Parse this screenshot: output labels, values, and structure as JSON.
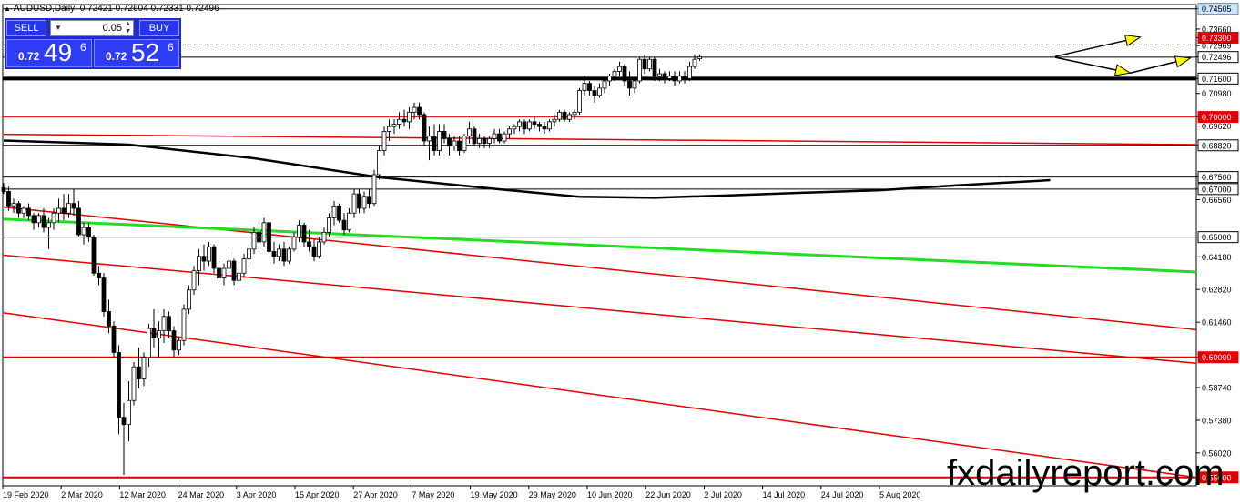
{
  "header": {
    "symbol": "AUDUSD,Daily",
    "open": "0.72421",
    "high": "0.72604",
    "low": "0.72331",
    "close": "0.72496"
  },
  "trade_panel": {
    "sell_label": "SELL",
    "buy_label": "BUY",
    "lot_size": "0.05",
    "sell_prefix": "0.72",
    "sell_main": "49",
    "sell_sup": "6",
    "buy_prefix": "0.72",
    "buy_main": "52",
    "buy_sup": "6"
  },
  "watermark": "fxdailyreport.com",
  "colors": {
    "up": "#ffffff",
    "down": "#000000",
    "level_red": "#e00000",
    "ma_green": "#22dd22",
    "ma_black": "#000000",
    "arrow": "#ffff00"
  },
  "chart_data": {
    "type": "candlestick",
    "title": "AUDUSD,Daily",
    "ylim": [
      0.5465,
      0.7468
    ],
    "grid": false,
    "x_ticks": [
      "19 Feb 2020",
      "2 Mar 2020",
      "12 Mar 2020",
      "24 Mar 2020",
      "3 Apr 2020",
      "15 Apr 2020",
      "27 Apr 2020",
      "7 May 2020",
      "19 May 2020",
      "29 May 2020",
      "10 Jun 2020",
      "22 Jun 2020",
      "2 Jul 2020",
      "14 Jul 2020",
      "24 Jul 2020",
      "5 Aug 2020"
    ],
    "y_ticks": [
      "0.74505",
      "0.73660",
      "0.73300",
      "0.72969",
      "0.72496",
      "0.71600",
      "0.70980",
      "0.70000",
      "0.69620",
      "0.68820",
      "0.67500",
      "0.67000",
      "0.66560",
      "0.65000",
      "0.64180",
      "0.62820",
      "0.61460",
      "0.60000",
      "0.58740",
      "0.57380",
      "0.56020",
      "0.55000"
    ],
    "highlighted_labels": [
      {
        "label": "0.74505",
        "value": 0.74505,
        "style": "blue"
      },
      {
        "label": "0.73300",
        "value": 0.733,
        "style": "red"
      },
      {
        "label": "0.72496",
        "value": 0.72496,
        "style": "current"
      },
      {
        "label": "0.71600",
        "value": 0.716,
        "style": "black"
      },
      {
        "label": "0.70000",
        "value": 0.7,
        "style": "red"
      },
      {
        "label": "0.68820",
        "value": 0.6882,
        "style": "black"
      },
      {
        "label": "0.67500",
        "value": 0.675,
        "style": "black"
      },
      {
        "label": "0.67000",
        "value": 0.67,
        "style": "black"
      },
      {
        "label": "0.65000",
        "value": 0.65,
        "style": "black"
      },
      {
        "label": "0.60000",
        "value": 0.6,
        "style": "red"
      },
      {
        "label": "0.55000",
        "value": 0.55,
        "style": "red"
      }
    ],
    "horizontal_levels": [
      {
        "value": 0.745,
        "color": "#000000",
        "width": 1
      },
      {
        "value": 0.73,
        "color": "#000000",
        "width": 1,
        "dash": true
      },
      {
        "value": 0.7249,
        "color": "#000000",
        "width": 1
      },
      {
        "value": 0.716,
        "color": "#000000",
        "width": 4
      },
      {
        "value": 0.7,
        "color": "#e00000",
        "width": 1
      },
      {
        "value": 0.6882,
        "color": "#000000",
        "width": 1
      },
      {
        "value": 0.675,
        "color": "#000000",
        "width": 1
      },
      {
        "value": 0.67,
        "color": "#000000",
        "width": 1
      },
      {
        "value": 0.65,
        "color": "#000000",
        "width": 1
      },
      {
        "value": 0.6,
        "color": "#e00000",
        "width": 2
      },
      {
        "value": 0.55,
        "color": "#e00000",
        "width": 2
      }
    ],
    "trendlines": [
      {
        "color": "#e00000",
        "width": 1.5,
        "from": [
          0,
          0.6928
        ],
        "to": [
          250,
          0.6885
        ]
      },
      {
        "color": "#e00000",
        "width": 1.5,
        "from": [
          0,
          0.6625
        ],
        "to": [
          250,
          0.6115
        ]
      },
      {
        "color": "#e00000",
        "width": 1.5,
        "from": [
          0,
          0.6425
        ],
        "to": [
          250,
          0.5975
        ]
      },
      {
        "color": "#e00000",
        "width": 1.5,
        "from": [
          0,
          0.6185
        ],
        "to": [
          250,
          0.55
        ]
      },
      {
        "color": "#22dd22",
        "width": 3,
        "from": [
          0,
          0.6575
        ],
        "to": [
          250,
          0.6355
        ]
      }
    ],
    "moving_average": {
      "color": "#000000",
      "points": [
        [
          0,
          0.6902
        ],
        [
          25,
          0.6885
        ],
        [
          50,
          0.6828
        ],
        [
          75,
          0.6749
        ],
        [
          100,
          0.6697
        ],
        [
          115,
          0.6668
        ],
        [
          130,
          0.6664
        ],
        [
          145,
          0.6674
        ],
        [
          160,
          0.6685
        ],
        [
          175,
          0.6695
        ],
        [
          190,
          0.6715
        ],
        [
          209,
          0.6737
        ]
      ]
    },
    "arrows": [
      {
        "from": [
          210,
          0.7252
        ],
        "to": [
          227,
          0.7332
        ]
      },
      {
        "from": [
          210,
          0.7248
        ],
        "to": [
          225,
          0.7183
        ]
      },
      {
        "from": [
          225,
          0.7183
        ],
        "to": [
          237,
          0.7245
        ]
      }
    ],
    "candles": [
      [
        0.6705,
        0.6725,
        0.668,
        0.669
      ],
      [
        0.669,
        0.671,
        0.661,
        0.663
      ],
      [
        0.663,
        0.666,
        0.66,
        0.664
      ],
      [
        0.664,
        0.665,
        0.658,
        0.66
      ],
      [
        0.66,
        0.663,
        0.658,
        0.662
      ],
      [
        0.662,
        0.664,
        0.657,
        0.659
      ],
      [
        0.659,
        0.66,
        0.653,
        0.656
      ],
      [
        0.656,
        0.66,
        0.654,
        0.659
      ],
      [
        0.659,
        0.662,
        0.652,
        0.654
      ],
      [
        0.654,
        0.658,
        0.645,
        0.656
      ],
      [
        0.656,
        0.662,
        0.653,
        0.66
      ],
      [
        0.66,
        0.666,
        0.656,
        0.662
      ],
      [
        0.662,
        0.668,
        0.657,
        0.66
      ],
      [
        0.66,
        0.668,
        0.658,
        0.664
      ],
      [
        0.664,
        0.67,
        0.659,
        0.662
      ],
      [
        0.662,
        0.665,
        0.65,
        0.651
      ],
      [
        0.651,
        0.656,
        0.647,
        0.654
      ],
      [
        0.654,
        0.656,
        0.648,
        0.65
      ],
      [
        0.65,
        0.651,
        0.634,
        0.635
      ],
      [
        0.635,
        0.638,
        0.63,
        0.633
      ],
      [
        0.633,
        0.635,
        0.617,
        0.619
      ],
      [
        0.619,
        0.624,
        0.61,
        0.613
      ],
      [
        0.613,
        0.615,
        0.6,
        0.602
      ],
      [
        0.602,
        0.605,
        0.568,
        0.575
      ],
      [
        0.575,
        0.581,
        0.551,
        0.572
      ],
      [
        0.572,
        0.59,
        0.565,
        0.582
      ],
      [
        0.582,
        0.598,
        0.58,
        0.596
      ],
      [
        0.596,
        0.604,
        0.587,
        0.591
      ],
      [
        0.591,
        0.602,
        0.588,
        0.6
      ],
      [
        0.6,
        0.614,
        0.596,
        0.612
      ],
      [
        0.612,
        0.62,
        0.604,
        0.608
      ],
      [
        0.608,
        0.615,
        0.6,
        0.611
      ],
      [
        0.611,
        0.62,
        0.606,
        0.617
      ],
      [
        0.617,
        0.619,
        0.608,
        0.611
      ],
      [
        0.611,
        0.613,
        0.6,
        0.603
      ],
      [
        0.603,
        0.608,
        0.601,
        0.607
      ],
      [
        0.607,
        0.622,
        0.605,
        0.62
      ],
      [
        0.62,
        0.63,
        0.618,
        0.628
      ],
      [
        0.628,
        0.638,
        0.626,
        0.636
      ],
      [
        0.636,
        0.645,
        0.63,
        0.642
      ],
      [
        0.642,
        0.647,
        0.636,
        0.64
      ],
      [
        0.64,
        0.648,
        0.638,
        0.646
      ],
      [
        0.646,
        0.647,
        0.635,
        0.637
      ],
      [
        0.637,
        0.64,
        0.629,
        0.633
      ],
      [
        0.633,
        0.639,
        0.63,
        0.637
      ],
      [
        0.637,
        0.644,
        0.635,
        0.64
      ],
      [
        0.64,
        0.641,
        0.63,
        0.632
      ],
      [
        0.632,
        0.638,
        0.628,
        0.635
      ],
      [
        0.635,
        0.643,
        0.633,
        0.641
      ],
      [
        0.641,
        0.647,
        0.639,
        0.645
      ],
      [
        0.645,
        0.654,
        0.643,
        0.652
      ],
      [
        0.652,
        0.656,
        0.645,
        0.648
      ],
      [
        0.648,
        0.658,
        0.646,
        0.656
      ],
      [
        0.656,
        0.656,
        0.643,
        0.644
      ],
      [
        0.644,
        0.648,
        0.639,
        0.642
      ],
      [
        0.642,
        0.647,
        0.64,
        0.645
      ],
      [
        0.645,
        0.648,
        0.638,
        0.64
      ],
      [
        0.64,
        0.646,
        0.639,
        0.645
      ],
      [
        0.645,
        0.652,
        0.644,
        0.65
      ],
      [
        0.65,
        0.657,
        0.648,
        0.655
      ],
      [
        0.655,
        0.656,
        0.646,
        0.648
      ],
      [
        0.648,
        0.653,
        0.644,
        0.646
      ],
      [
        0.646,
        0.649,
        0.64,
        0.642
      ],
      [
        0.642,
        0.65,
        0.641,
        0.648
      ],
      [
        0.648,
        0.654,
        0.647,
        0.652
      ],
      [
        0.652,
        0.66,
        0.65,
        0.658
      ],
      [
        0.658,
        0.665,
        0.655,
        0.663
      ],
      [
        0.663,
        0.664,
        0.656,
        0.657
      ],
      [
        0.657,
        0.66,
        0.651,
        0.653
      ],
      [
        0.653,
        0.662,
        0.652,
        0.66
      ],
      [
        0.66,
        0.67,
        0.658,
        0.668
      ],
      [
        0.668,
        0.67,
        0.66,
        0.662
      ],
      [
        0.662,
        0.669,
        0.66,
        0.667
      ],
      [
        0.667,
        0.67,
        0.662,
        0.664
      ],
      [
        0.664,
        0.678,
        0.663,
        0.676
      ],
      [
        0.676,
        0.688,
        0.674,
        0.686
      ],
      [
        0.686,
        0.696,
        0.684,
        0.694
      ],
      [
        0.694,
        0.699,
        0.69,
        0.696
      ],
      [
        0.696,
        0.699,
        0.693,
        0.697
      ],
      [
        0.697,
        0.702,
        0.695,
        0.699
      ],
      [
        0.699,
        0.703,
        0.696,
        0.698
      ],
      [
        0.698,
        0.704,
        0.695,
        0.702
      ],
      [
        0.702,
        0.706,
        0.699,
        0.704
      ],
      [
        0.704,
        0.706,
        0.699,
        0.701
      ],
      [
        0.701,
        0.702,
        0.688,
        0.69
      ],
      [
        0.69,
        0.696,
        0.682,
        0.692
      ],
      [
        0.692,
        0.697,
        0.684,
        0.686
      ],
      [
        0.686,
        0.697,
        0.684,
        0.694
      ],
      [
        0.694,
        0.697,
        0.689,
        0.691
      ],
      [
        0.691,
        0.693,
        0.684,
        0.688
      ],
      [
        0.688,
        0.692,
        0.686,
        0.69
      ],
      [
        0.69,
        0.692,
        0.684,
        0.686
      ],
      [
        0.686,
        0.693,
        0.685,
        0.692
      ],
      [
        0.692,
        0.698,
        0.689,
        0.695
      ],
      [
        0.695,
        0.696,
        0.688,
        0.689
      ],
      [
        0.689,
        0.693,
        0.687,
        0.691
      ],
      [
        0.691,
        0.692,
        0.687,
        0.689
      ],
      [
        0.689,
        0.692,
        0.687,
        0.691
      ],
      [
        0.691,
        0.695,
        0.689,
        0.693
      ],
      [
        0.693,
        0.695,
        0.689,
        0.69
      ],
      [
        0.69,
        0.694,
        0.689,
        0.693
      ],
      [
        0.693,
        0.696,
        0.691,
        0.695
      ],
      [
        0.695,
        0.697,
        0.693,
        0.696
      ],
      [
        0.696,
        0.699,
        0.694,
        0.698
      ],
      [
        0.698,
        0.699,
        0.693,
        0.695
      ],
      [
        0.695,
        0.699,
        0.694,
        0.698
      ],
      [
        0.698,
        0.7,
        0.695,
        0.697
      ],
      [
        0.697,
        0.698,
        0.694,
        0.696
      ],
      [
        0.696,
        0.698,
        0.693,
        0.695
      ],
      [
        0.695,
        0.699,
        0.694,
        0.698
      ],
      [
        0.698,
        0.701,
        0.696,
        0.699
      ],
      [
        0.699,
        0.703,
        0.698,
        0.702
      ],
      [
        0.702,
        0.703,
        0.698,
        0.699
      ],
      [
        0.699,
        0.702,
        0.698,
        0.701
      ],
      [
        0.701,
        0.703,
        0.699,
        0.702
      ],
      [
        0.702,
        0.712,
        0.701,
        0.711
      ],
      [
        0.711,
        0.717,
        0.709,
        0.714
      ],
      [
        0.714,
        0.715,
        0.709,
        0.711
      ],
      [
        0.711,
        0.713,
        0.706,
        0.709
      ],
      [
        0.709,
        0.714,
        0.708,
        0.712
      ],
      [
        0.712,
        0.716,
        0.71,
        0.715
      ],
      [
        0.715,
        0.718,
        0.713,
        0.717
      ],
      [
        0.717,
        0.72,
        0.715,
        0.719
      ],
      [
        0.719,
        0.723,
        0.717,
        0.721
      ],
      [
        0.721,
        0.722,
        0.713,
        0.715
      ],
      [
        0.715,
        0.719,
        0.709,
        0.712
      ],
      [
        0.712,
        0.716,
        0.71,
        0.715
      ],
      [
        0.715,
        0.725,
        0.714,
        0.724
      ],
      [
        0.724,
        0.726,
        0.718,
        0.72
      ],
      [
        0.72,
        0.725,
        0.719,
        0.724
      ],
      [
        0.724,
        0.725,
        0.715,
        0.717
      ],
      [
        0.717,
        0.72,
        0.715,
        0.718
      ],
      [
        0.718,
        0.719,
        0.714,
        0.716
      ],
      [
        0.716,
        0.719,
        0.715,
        0.717
      ],
      [
        0.717,
        0.719,
        0.713,
        0.715
      ],
      [
        0.715,
        0.719,
        0.714,
        0.717
      ],
      [
        0.717,
        0.719,
        0.714,
        0.716
      ],
      [
        0.716,
        0.723,
        0.715,
        0.721
      ],
      [
        0.721,
        0.726,
        0.72,
        0.724
      ],
      [
        0.72421,
        0.72604,
        0.72331,
        0.72496
      ]
    ]
  }
}
